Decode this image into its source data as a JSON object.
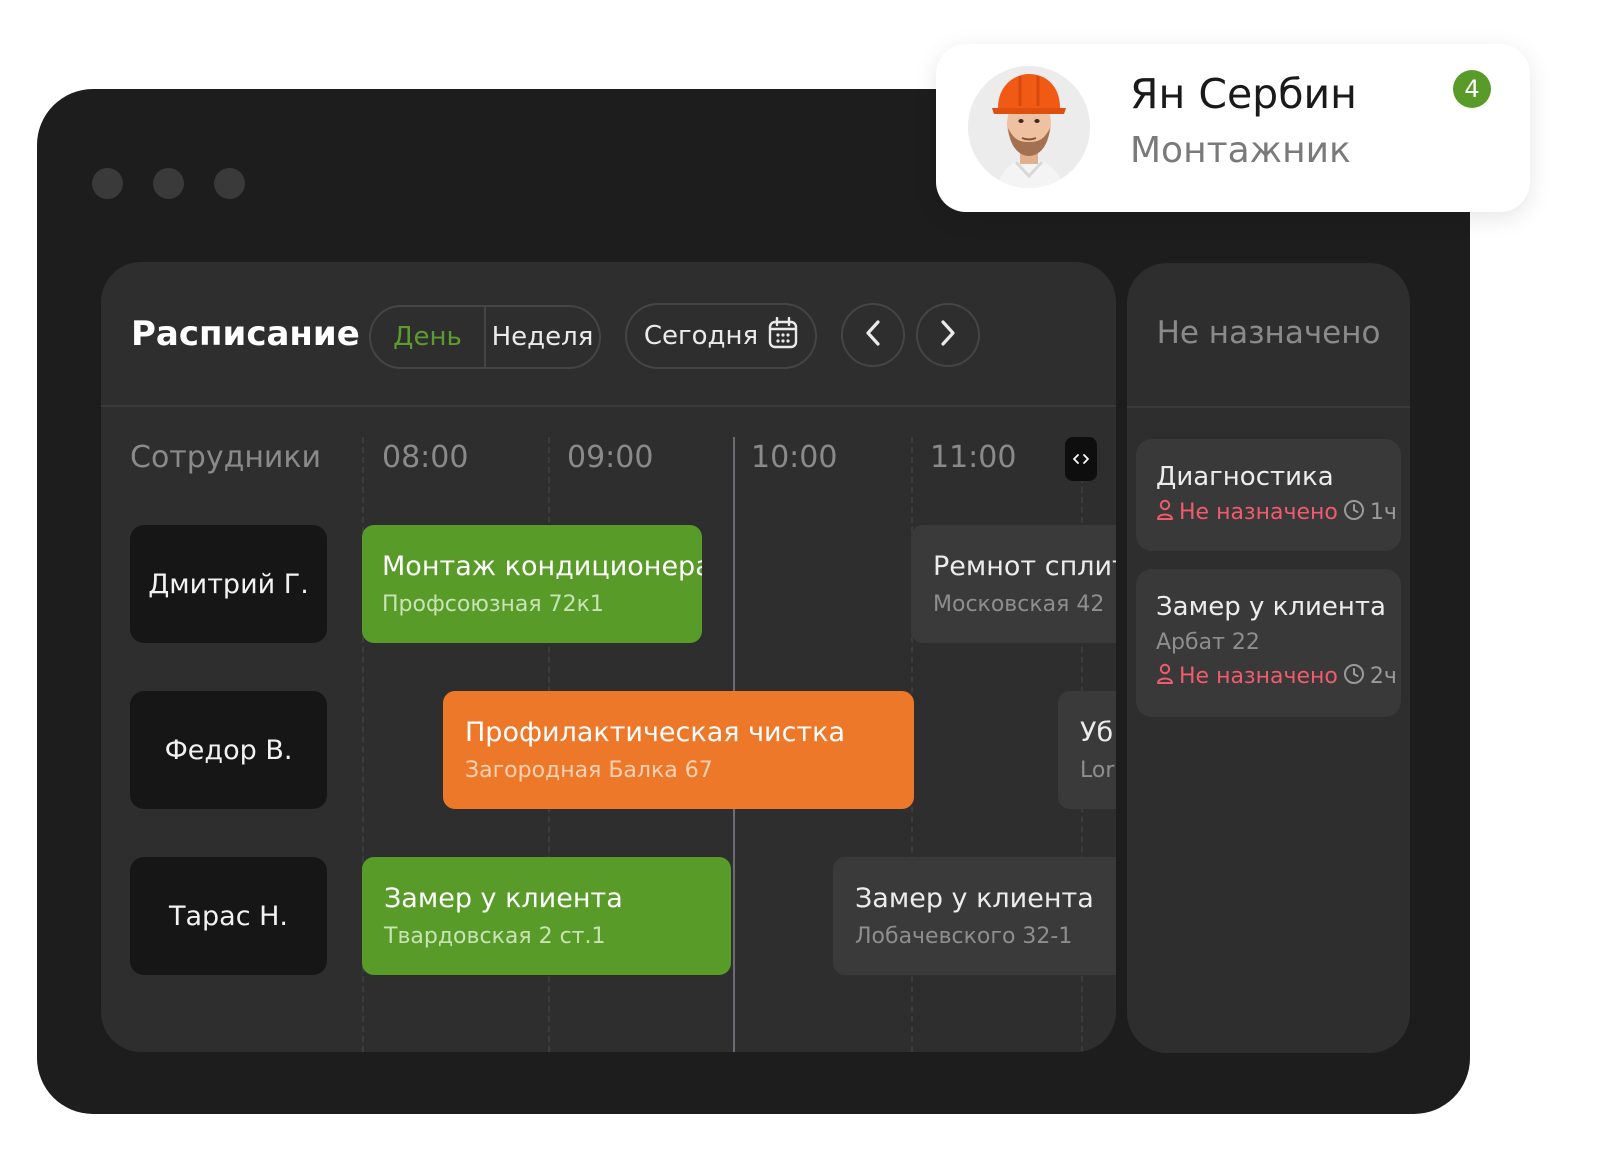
{
  "window": {
    "controls": [
      "dot",
      "dot",
      "dot"
    ]
  },
  "schedule": {
    "title": "Расписание",
    "view_toggle": {
      "day": "День",
      "week": "Неделя",
      "active": "День"
    },
    "today_label": "Сегодня",
    "employees_header": "Сотрудники",
    "hours": [
      "08:00",
      "09:00",
      "10:00",
      "11:00"
    ],
    "employees": [
      {
        "name": "Дмитрий Г."
      },
      {
        "name": "Федор В."
      },
      {
        "name": "Тарас Н."
      }
    ],
    "events": [
      {
        "title": "Монтаж кондиционера",
        "address": "Профсоюзная 72к1",
        "color": "#599b29"
      },
      {
        "title": "Ремнот сплит",
        "address": "Московская 42",
        "color": "#3a3a3a"
      },
      {
        "title": "Профилактическая чистка",
        "address": "Загородная Балка 67",
        "color": "#ee782a"
      },
      {
        "title": "Уб",
        "address": "Lor",
        "color": "#3a3a3a"
      },
      {
        "title": "Замер у клиента",
        "address": "Твардовская 2 ст.1",
        "color": "#599b29"
      },
      {
        "title": "Замер у клиента",
        "address": "Лобачевского 32-1",
        "color": "#3a3a3a"
      }
    ]
  },
  "unassigned": {
    "title": "Не назначено",
    "cards": [
      {
        "title": "Диагностика",
        "status": "Не назначено",
        "duration": "1ч"
      },
      {
        "title": "Замер у клиента",
        "address": "Арбат 22",
        "status": "Не назначено",
        "duration": "2ч"
      }
    ]
  },
  "profile": {
    "name": "Ян Сербин",
    "role": "Монтажник",
    "badge": "4"
  },
  "colors": {
    "accent_green": "#599b29",
    "accent_orange": "#ee782a",
    "status_red": "#f05b6e"
  }
}
